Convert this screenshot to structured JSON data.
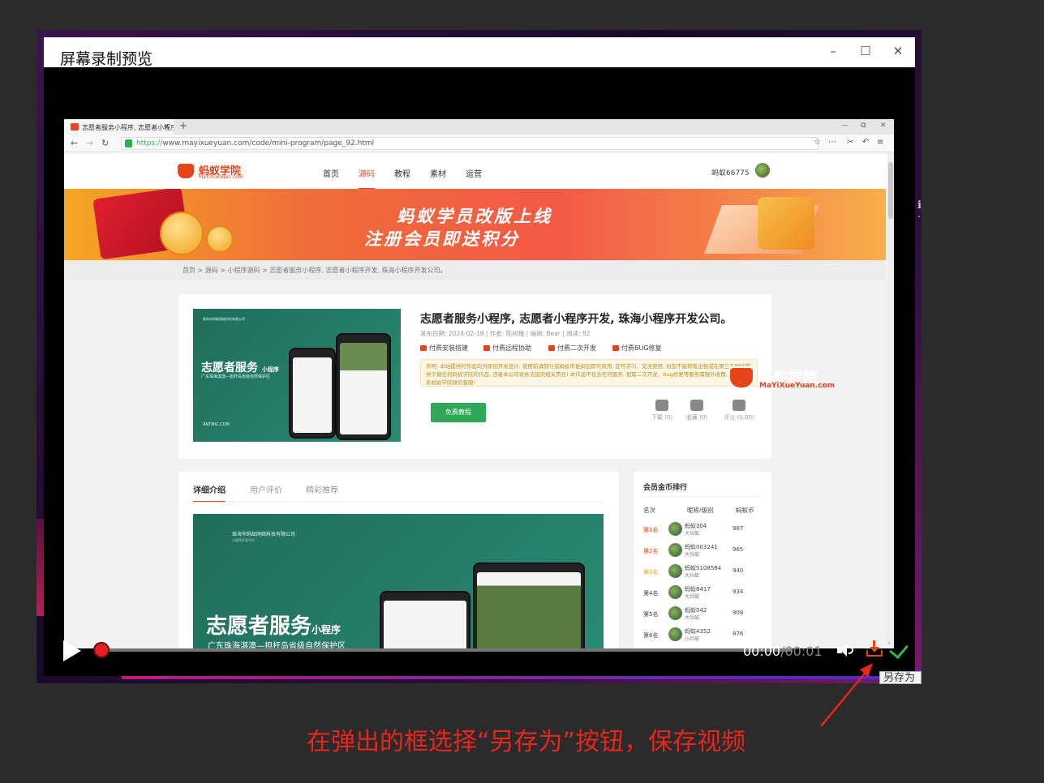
{
  "preview_window": {
    "title": "屏幕录制预览",
    "controls": {
      "minimize": "–",
      "maximize": "☐",
      "close": "✕"
    }
  },
  "browser": {
    "tab_title": "志愿者服务小程序, 志愿者小程序",
    "tab_close": "×",
    "new_tab": "+",
    "url_scheme": "https://",
    "url_rest": "www.mayixueyuan.com/code/mini-program/page_92.html"
  },
  "site": {
    "logo_name": "蚂蚁学院",
    "logo_sub": "MaYiXueYuan.com",
    "menu": [
      "首页",
      "源码",
      "教程",
      "素材",
      "运营"
    ],
    "active_menu": "源码",
    "username": "蚂蚁66775",
    "banner_line1": "蚂蚁学员改版上线",
    "banner_line2": "注册会员即送积分",
    "breadcrumb": "首页  >   源码  >   小程序源码  >   志愿者服务小程序, 志愿者小程序开发, 珠海小程序开发公司。"
  },
  "product": {
    "title": "志愿者服务小程序, 志愿者小程序开发, 珠海小程序开发公司。",
    "meta": "发布日期: 2024-02-19  |  作者: 陈树槐  |  编辑: Bear  |  阅读: 82",
    "services": [
      "付费安装搭建",
      "付费远程协助",
      "付费二次开发",
      "付费BUG修复"
    ],
    "notice": "声明: 本站提供的作品均为原创开发设计, 使用前请部分或蚂蚁币抵扣后即可商用, 您可学习、交流使用, 但您不能转售出租或在第三方网站提供下载任何蚂蚁学院的作品, 违者本公司将依法追究相关责任! 本作品不包含任何服务, 如需二次开发、bug修复等服务需额外收费, 具体请联系蚂蚁学院微信客服!",
    "free_button": "免费教程",
    "stats": [
      {
        "label": "下载 (0)",
        "icon": "download-icon"
      },
      {
        "label": "收藏 (0)",
        "icon": "star-icon"
      },
      {
        "label": "评分 (0.00)",
        "icon": "trophy-icon"
      }
    ],
    "thumb_company": "珠海市蚂蚁网络科技有限公司",
    "thumb_big": "志愿者服务",
    "thumb_big_small": "小程序",
    "thumb_tag": "广东珠海淇澳—担杆岛省级自然保护区",
    "thumb_foot": "ANTMIC.COM"
  },
  "detail": {
    "tabs": [
      "详细介绍",
      "用户评价",
      "精彩推荐"
    ],
    "img_company": "珠海市蚂蚁网络科技有限公司",
    "img_company_sub": "小程序开发平台",
    "img_big": "志愿者服务",
    "img_big_small": "小程序",
    "img_tag": "广东珠海淇澳—担杆岛省级自然保护区"
  },
  "ranking": {
    "title": "会员金币排行",
    "headers": [
      "名次",
      "昵称/级别",
      "蚂蚁币"
    ],
    "rows": [
      {
        "pos": "第1名",
        "name": "蚂蚁304",
        "level": "大兵蚁",
        "coins": "987",
        "color": "#e8441a"
      },
      {
        "pos": "第2名",
        "name": "蚂蚁003241",
        "level": "大兵蚁",
        "coins": "965",
        "color": "#e8441a"
      },
      {
        "pos": "第3名",
        "name": "蚂蚁5108584",
        "level": "大兵蚁",
        "coins": "940",
        "color": "#f0a020"
      },
      {
        "pos": "第4名",
        "name": "蚂蚁8417",
        "level": "大兵蚁",
        "coins": "934",
        "color": "#444444"
      },
      {
        "pos": "第5名",
        "name": "蚂蚁042",
        "level": "大兵蚁",
        "coins": "908",
        "color": "#444444"
      },
      {
        "pos": "第6名",
        "name": "蚂蚁4352",
        "level": "小兵蚁",
        "coins": "876",
        "color": "#444444"
      }
    ]
  },
  "watermark": {
    "name": "蚂蚁学院",
    "sub": "MaYiXueYuan.com"
  },
  "player": {
    "time_current": "00:00",
    "time_total": "/00:01",
    "progress": 0
  },
  "tooltip": "另存为",
  "caption": "在弹出的框选择“另存为”按钮，保存视频",
  "colors": {
    "accent": "#e8441a",
    "caption": "#e8261c",
    "confirm": "#3ab54a"
  }
}
